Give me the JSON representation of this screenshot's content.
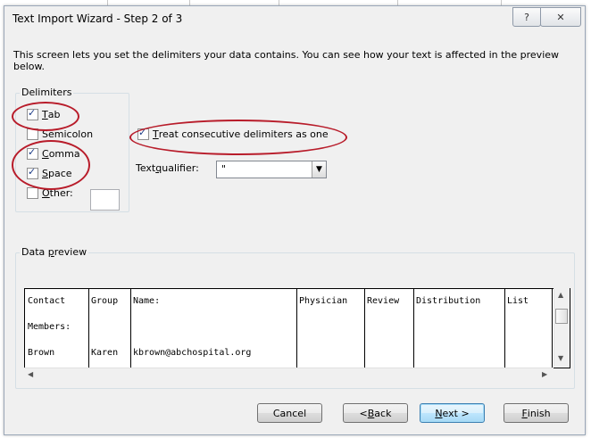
{
  "window": {
    "title": "Text Import Wizard - Step 2 of 3",
    "help_glyph": "?",
    "close_glyph": "✕"
  },
  "description": "This screen lets you set the delimiters your data contains.  You can see how your text is affected in the preview below.",
  "delimiters": {
    "label": "Delimiters",
    "tab": {
      "label_ul": "T",
      "label_rest": "ab",
      "checked": true
    },
    "semicolon": {
      "label_ul": "",
      "label_rest": "Semicolon",
      "checked": false
    },
    "comma": {
      "label_ul": "C",
      "label_rest": "omma",
      "checked": true
    },
    "space": {
      "label_ul": "S",
      "label_rest": "pace",
      "checked": true
    },
    "other": {
      "label_ul": "O",
      "label_rest": "ther:",
      "checked": false,
      "value": ""
    }
  },
  "consecutive": {
    "label_ul": "T",
    "label_rest": "reat consecutive delimiters as one",
    "checked": true
  },
  "qualifier": {
    "label_pre": "Text ",
    "label_ul": "q",
    "label_rest": "ualifier:",
    "value": "\""
  },
  "preview": {
    "label_pre": "Data ",
    "label_ul": "p",
    "label_rest": "review",
    "rows": [
      [
        "Contact",
        "Group",
        "Name:",
        "",
        "Physician",
        "Review",
        "Distribution",
        "List"
      ],
      [
        "Members:",
        "",
        "",
        "",
        "",
        "",
        "",
        ""
      ],
      [
        "Brown",
        "Karen",
        "kbrown@abchospital.org",
        "",
        "",
        "",
        "",
        ""
      ]
    ]
  },
  "buttons": {
    "cancel": "Cancel",
    "back_pre": "< ",
    "back_ul": "B",
    "back_rest": "ack",
    "next_ul": "N",
    "next_rest": "ext >",
    "finish_ul": "F",
    "finish_rest": "inish"
  },
  "highlight_color": "#b81c2a"
}
